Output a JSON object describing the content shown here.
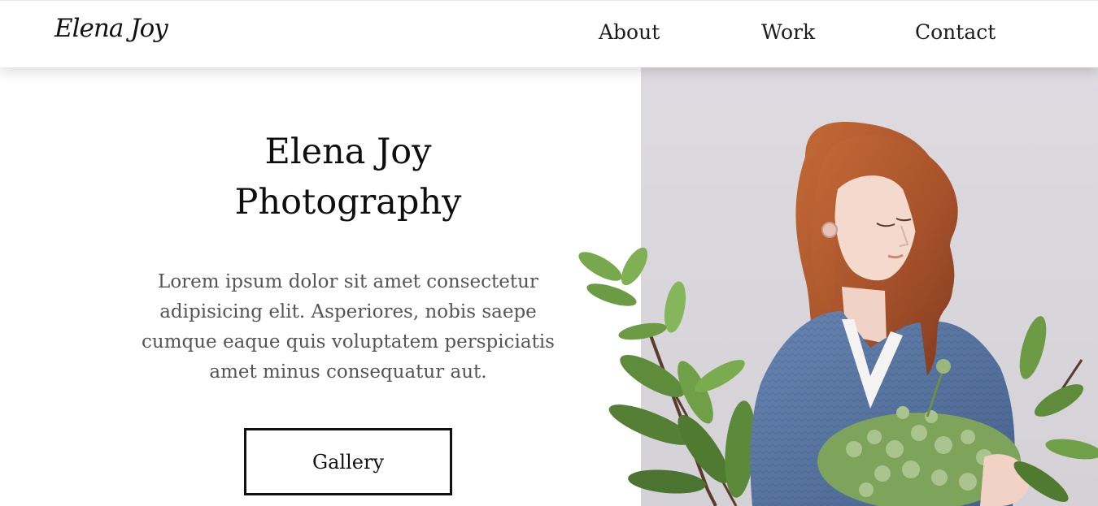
{
  "header": {
    "logo": "Elena Joy",
    "nav": {
      "about": "About",
      "work": "Work",
      "contact": "Contact"
    }
  },
  "hero": {
    "title_line1": "Elena Joy",
    "title_line2": "Photography",
    "body": "Lorem ipsum dolor sit amet consectetur adipisicing elit. Asperiores, nobis saepe cumque eaque quis voluptatem perspiciatis amet minus consequatur aut.",
    "button_label": "Gallery"
  },
  "colors": {
    "photo_backdrop": "#dbd9de",
    "sweater": "#5a78a4",
    "hair": "#b0562c",
    "leaf": "#6d9a45",
    "text_body": "#555555"
  }
}
